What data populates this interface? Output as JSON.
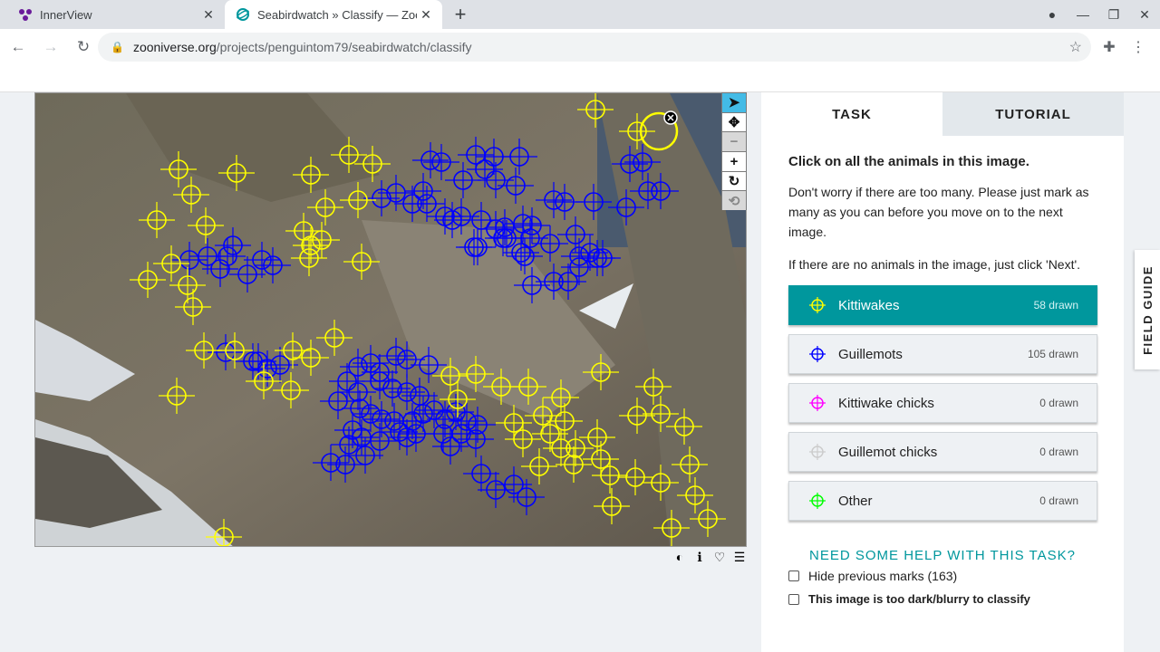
{
  "browser": {
    "tabs": [
      {
        "title": "InnerView",
        "icon": "innerview-icon",
        "active": false
      },
      {
        "title": "Seabirdwatch » Classify — Zooni",
        "icon": "zooniverse-icon",
        "active": true
      }
    ],
    "url_host": "zooniverse.org",
    "url_path": "/projects/penguintom79/seabirdwatch/classify"
  },
  "image_tools": [
    "pointer-icon",
    "move-icon",
    "zoom-out-icon",
    "zoom-in-icon",
    "rotate-icon",
    "reset-icon"
  ],
  "meta_tools": [
    "invert-icon",
    "info-icon",
    "favorite-icon",
    "collections-icon"
  ],
  "task": {
    "tabs": [
      "TASK",
      "TUTORIAL"
    ],
    "question": "Click on all the animals in this image.",
    "instructions": [
      "Don't worry if there are too many. Please just mark as many as you can before you move on to the next image.",
      "If there are no animals in the image, just click 'Next'."
    ],
    "tools": [
      {
        "label": "Kittiwakes",
        "count": "58 drawn",
        "color": "#ffff00",
        "selected": true
      },
      {
        "label": "Guillemots",
        "count": "105 drawn",
        "color": "#0000ff",
        "selected": false
      },
      {
        "label": "Kittiwake chicks",
        "count": "0 drawn",
        "color": "#ff00ff",
        "selected": false
      },
      {
        "label": "Guillemot chicks",
        "count": "0 drawn",
        "color": "#cccccc",
        "selected": false
      },
      {
        "label": "Other",
        "count": "0 drawn",
        "color": "#00ff00",
        "selected": false
      }
    ],
    "help": "NEED SOME HELP WITH THIS TASK?",
    "hide_marks": "Hide previous marks (163)",
    "too_dark": "This image is too dark/blurry to classify"
  },
  "field_guide": "FIELD GUIDE"
}
